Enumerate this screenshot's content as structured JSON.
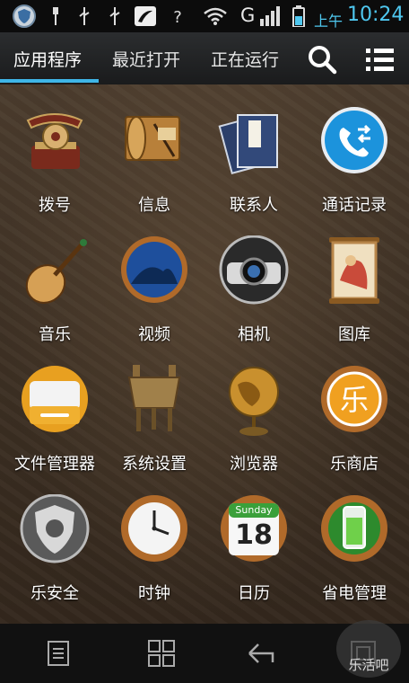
{
  "status_bar": {
    "icons": [
      "security-shield-icon",
      "usb-icon",
      "usb-icon",
      "usb-icon",
      "media-icon",
      "wifi-unknown-icon",
      "wifi-icon",
      "signal-icon",
      "battery-icon"
    ],
    "network_letter": "G",
    "ampm": "上午",
    "time": "10:24"
  },
  "tabs": [
    {
      "label": "应用程序",
      "active": true
    },
    {
      "label": "最近打开",
      "active": false
    },
    {
      "label": "正在运行",
      "active": false
    }
  ],
  "toolbar": {
    "search_icon": "search-icon",
    "menu_icon": "list-icon"
  },
  "apps": [
    {
      "label": "拨号",
      "icon": "phone-icon"
    },
    {
      "label": "信息",
      "icon": "scroll-letter-icon"
    },
    {
      "label": "联系人",
      "icon": "books-icon"
    },
    {
      "label": "通话记录",
      "icon": "call-log-icon"
    },
    {
      "label": "音乐",
      "icon": "lute-icon"
    },
    {
      "label": "视频",
      "icon": "video-icon"
    },
    {
      "label": "相机",
      "icon": "camera-icon"
    },
    {
      "label": "图库",
      "icon": "painting-scroll-icon"
    },
    {
      "label": "文件管理器",
      "icon": "folder-box-icon"
    },
    {
      "label": "系统设置",
      "icon": "bronze-vessel-icon"
    },
    {
      "label": "浏览器",
      "icon": "globe-icon"
    },
    {
      "label": "乐商店",
      "icon": "store-icon"
    },
    {
      "label": "乐安全",
      "icon": "shield-icon"
    },
    {
      "label": "时钟",
      "icon": "clock-icon"
    },
    {
      "label": "日历",
      "icon": "calendar-icon"
    },
    {
      "label": "省电管理",
      "icon": "battery-saver-icon"
    }
  ],
  "calendar": {
    "weekday": "Sunday",
    "day": "18"
  },
  "nav": [
    "menu-icon",
    "home-grid-icon",
    "back-icon",
    "recent-apps-icon"
  ],
  "watermark": "乐活吧",
  "colors": {
    "accent": "#3fb6e8",
    "tabbar": "#1f2022",
    "wallpaper": "#3e3024"
  }
}
